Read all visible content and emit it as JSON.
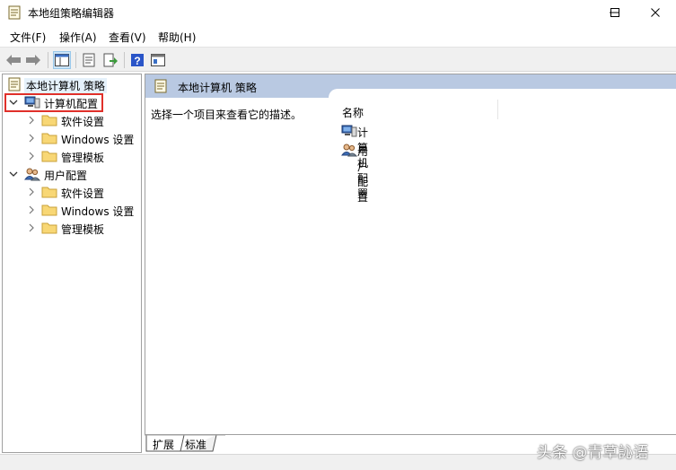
{
  "window": {
    "title": "本地组策略编辑器"
  },
  "menu": [
    {
      "label": "文件(F)"
    },
    {
      "label": "操作(A)"
    },
    {
      "label": "查看(V)"
    },
    {
      "label": "帮助(H)"
    }
  ],
  "toolbar": {
    "icons": [
      "back-arrow-icon",
      "forward-arrow-icon",
      "show-tree-icon",
      "properties-icon",
      "export-list-icon",
      "help-icon",
      "show-console-icon"
    ]
  },
  "tree": {
    "root": "本地计算机 策略",
    "computer_config": "计算机配置",
    "computer_children": [
      "软件设置",
      "Windows 设置",
      "管理模板"
    ],
    "user_config": "用户配置",
    "user_children": [
      "软件设置",
      "Windows 设置",
      "管理模板"
    ]
  },
  "content": {
    "header_title": "本地计算机 策略",
    "description": "选择一个项目来查看它的描述。",
    "column_name": "名称",
    "items": [
      {
        "label": "计算机配置",
        "icon": "computer-icon"
      },
      {
        "label": "用户配置",
        "icon": "users-icon"
      }
    ]
  },
  "tabs": [
    {
      "label": "扩展",
      "active": true
    },
    {
      "label": "标准",
      "active": false
    }
  ],
  "watermark": "头条 @青草訫语",
  "colors": {
    "highlight": "#e0302a",
    "header_bg": "#b9c9e2",
    "help_icon": "#2a55c8"
  }
}
